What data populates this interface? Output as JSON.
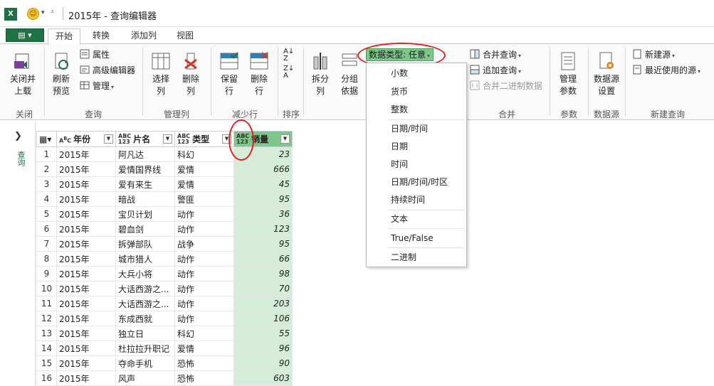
{
  "app": {
    "title": "2015年 - 查询编辑器",
    "excel_badge": "X"
  },
  "tabs": [
    {
      "label": "开始",
      "active": true
    },
    {
      "label": "转换",
      "active": false
    },
    {
      "label": "添加列",
      "active": false
    },
    {
      "label": "视图",
      "active": false
    }
  ],
  "ribbon": {
    "close_load": "关闭并\n上载",
    "refresh_preview": "刷新\n预览",
    "properties": "属性",
    "advanced_editor": "高级编辑器",
    "manage": "管理",
    "select_columns": "选择\n列",
    "remove_columns": "删除\n列",
    "keep_rows": "保留\n行",
    "remove_rows": "删除\n行",
    "split": "拆分\n列",
    "group_by": "分组\n依据",
    "data_type": "数据类型: 任意",
    "merge_queries": "合并查询",
    "append_queries": "追加查询",
    "combine_binaries": "合并二进制数据",
    "manage_params": "管理\n参数",
    "data_source_settings": "数据源\n设置",
    "new_source": "新建源",
    "recent_sources": "最近使用的源"
  },
  "groups": {
    "close": "关闭",
    "query": "查询",
    "manage_columns": "管理列",
    "reduce_rows": "减少行",
    "sort": "排序",
    "combine": "合并",
    "parameters": "参数",
    "data_source": "数据源",
    "new_query": "新建查询"
  },
  "data_type_menu": [
    "小数",
    "货币",
    "整数",
    "日期/时间",
    "日期",
    "时间",
    "日期/时间/时区",
    "持续时间",
    "文本",
    "True/False",
    "二进制"
  ],
  "left_pane": {
    "label": "查询"
  },
  "table": {
    "type_badges": {
      "text": "Aᴮ C",
      "any": "ABC\n123"
    },
    "columns": [
      "年份",
      "片名",
      "类型",
      "销量"
    ],
    "rows": [
      [
        "1",
        "2015年",
        "阿凡达",
        "科幻",
        "23"
      ],
      [
        "2",
        "2015年",
        "爱情国界线",
        "爱情",
        "666"
      ],
      [
        "3",
        "2015年",
        "爱有来生",
        "爱情",
        "45"
      ],
      [
        "4",
        "2015年",
        "暗战",
        "警匪",
        "95"
      ],
      [
        "5",
        "2015年",
        "宝贝计划",
        "动作",
        "36"
      ],
      [
        "6",
        "2015年",
        "碧血剑",
        "动作",
        "123"
      ],
      [
        "7",
        "2015年",
        "拆弹部队",
        "战争",
        "95"
      ],
      [
        "8",
        "2015年",
        "城市猎人",
        "动作",
        "66"
      ],
      [
        "9",
        "2015年",
        "大兵小将",
        "动作",
        "98"
      ],
      [
        "10",
        "2015年",
        "大话西游之...",
        "动作",
        "70"
      ],
      [
        "11",
        "2015年",
        "大话西游之...",
        "动作",
        "203"
      ],
      [
        "12",
        "2015年",
        "东成西就",
        "动作",
        "106"
      ],
      [
        "13",
        "2015年",
        "独立日",
        "科幻",
        "55"
      ],
      [
        "14",
        "2015年",
        "杜拉拉升职记",
        "爱情",
        "96"
      ],
      [
        "15",
        "2015年",
        "夺命手机",
        "恐怖",
        "90"
      ],
      [
        "16",
        "2015年",
        "风声",
        "恐怖",
        "603"
      ]
    ]
  },
  "colors": {
    "accent": "#1f7244",
    "highlight": "#7ec78a",
    "annotation": "#e02020"
  }
}
